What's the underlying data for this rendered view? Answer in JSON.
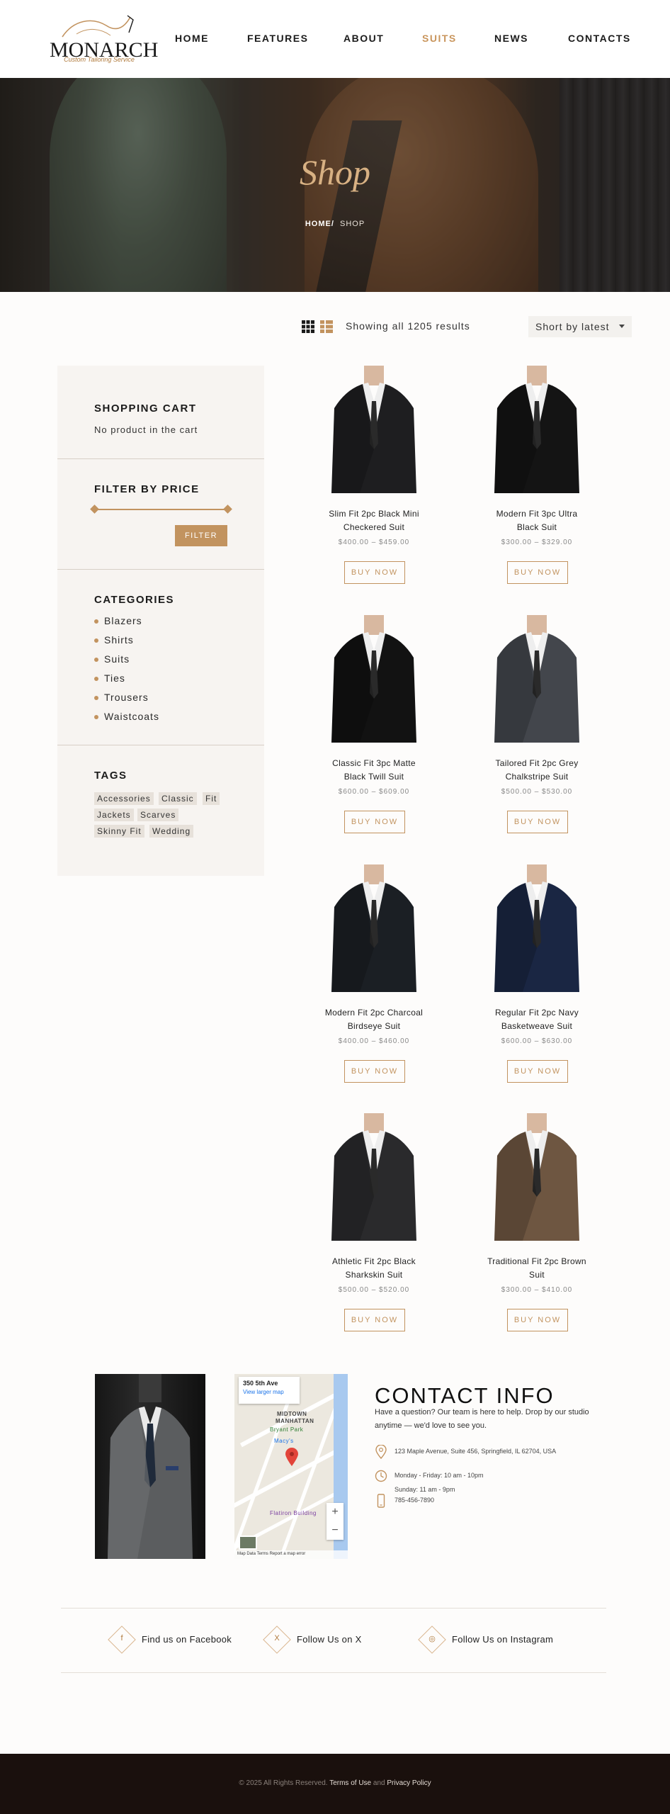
{
  "brand": {
    "name": "MONARCH",
    "tagline": "Custom Tailoring Service",
    "accent": "#c2935f",
    "dark": "#1a100d"
  },
  "nav": {
    "items": [
      "HOME",
      "FEATURES",
      "ABOUT",
      "SUITS",
      "NEWS",
      "CONTACTS"
    ],
    "active": "SUITS"
  },
  "hero": {
    "title": "Shop",
    "breadcrumb_home": "HOME/",
    "breadcrumb_current": "SHOP"
  },
  "toolbar": {
    "grid_icon": "grid-view-icon",
    "list_icon": "list-view-icon",
    "result_count": "Showing all 1205 results",
    "sort_value": "Short by latest"
  },
  "sidebar": {
    "cart_title": "SHOPPING CART",
    "cart_empty": "No product in the cart",
    "price_title": "FILTER BY PRICE",
    "filter_button": "FILTER",
    "categories_title": "CATEGORIES",
    "categories": [
      "Blazers",
      "Shirts",
      "Suits",
      "Ties",
      "Trousers",
      "Waistcoats"
    ],
    "tags_title": "TAGS",
    "tags": [
      "Accessories",
      "Classic",
      "Fit",
      "Jackets",
      "Scarves",
      "Skinny Fit",
      "Wedding"
    ]
  },
  "products": [
    {
      "name_1": "Slim Fit 2pc Black Mini",
      "name_2": "Checkered Suit",
      "price": "$400.00 – $459.00",
      "button": "BUY NOW",
      "color": "#1e1e20"
    },
    {
      "name_1": "Modern Fit 3pc Ultra",
      "name_2": "Black Suit",
      "price": "$300.00 – $329.00",
      "button": "BUY NOW",
      "color": "#141414"
    },
    {
      "name_1": "Classic Fit 3pc Matte",
      "name_2": "Black Twill Suit",
      "price": "$600.00 – $609.00",
      "button": "BUY NOW",
      "color": "#121212"
    },
    {
      "name_1": "Tailored Fit 2pc Grey",
      "name_2": "Chalkstripe Suit",
      "price": "$500.00 – $530.00",
      "button": "BUY NOW",
      "color": "#43464c"
    },
    {
      "name_1": "Modern Fit 2pc Charcoal",
      "name_2": "Birdseye Suit",
      "price": "$400.00 – $460.00",
      "button": "BUY NOW",
      "color": "#1b1f24"
    },
    {
      "name_1": "Regular Fit 2pc Navy",
      "name_2": "Basketweave Suit",
      "price": "$600.00 – $630.00",
      "button": "BUY NOW",
      "color": "#1a2643"
    },
    {
      "name_1": "Athletic Fit 2pc Black",
      "name_2": "Sharkskin Suit",
      "price": "$500.00 – $520.00",
      "button": "BUY NOW",
      "color": "#2a2a2c"
    },
    {
      "name_1": "Traditional Fit 2pc Brown",
      "name_2": "Suit",
      "price": "$300.00 – $410.00",
      "button": "BUY NOW",
      "color": "#6e5641"
    }
  ],
  "map": {
    "address_title": "350 5th Ave",
    "larger_map": "View larger map",
    "label_midtown": "MIDTOWN",
    "label_manhattan": "MANHATTAN",
    "label_bryant": "Bryant Park",
    "label_macys": "Macy's",
    "label_flatiron": "Flatiron Building",
    "zoom_in": "+",
    "zoom_out": "−",
    "footer": "Map Data   Terms   Report a map error"
  },
  "contact": {
    "title": "CONTACT INFO",
    "intro": "Have a question? Our team is here to help. Drop by our studio anytime — we'd love to see you.",
    "address": "123 Maple Avenue, Suite 456, Springfield, IL 62704, USA",
    "hours_weekday": "Monday - Friday: 10 am - 10pm",
    "hours_sunday": "Sunday: 11 am - 9pm",
    "phone": "785-456-7890"
  },
  "social": [
    {
      "label": "Find us on Facebook",
      "icon": "facebook-icon",
      "glyph": "f"
    },
    {
      "label": "Follow Us on X",
      "icon": "x-icon",
      "glyph": "X"
    },
    {
      "label": "Follow Us on Instagram",
      "icon": "instagram-icon",
      "glyph": "◎"
    }
  ],
  "footer": {
    "copyright": "© 2025 All Rights Reserved.",
    "terms": "Terms of Use",
    "and": "and",
    "privacy": "Privacy Policy"
  }
}
